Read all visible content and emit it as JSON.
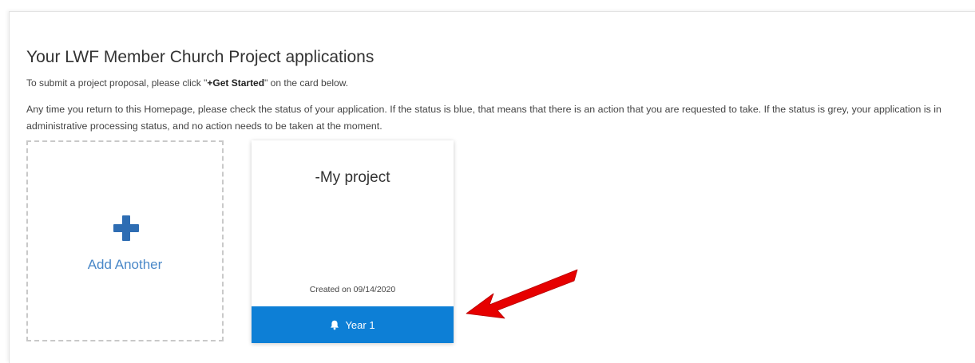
{
  "page": {
    "title": "Your LWF Member Church Project applications",
    "intro_prefix": "To submit a project proposal, please click \"",
    "intro_bold": "+Get Started",
    "intro_suffix": "\" on the card below.",
    "notice": "Any time you return to this Homepage, please check the status of your application. If the status is blue, that means that there is an action that you are requested to take. If the status is grey, your application is in administrative processing status, and no action needs to be taken at the moment."
  },
  "add_card": {
    "icon": "plus-icon",
    "label": "Add Another"
  },
  "project_card": {
    "title": "-My project",
    "created": "Created on 09/14/2020",
    "status_icon": "bell-icon",
    "status_label": "Year 1",
    "status_color": "#0d7fd6"
  },
  "colors": {
    "accent": "#2e6db3",
    "add_label": "#4a88c8",
    "annotation_arrow": "#e60000"
  }
}
